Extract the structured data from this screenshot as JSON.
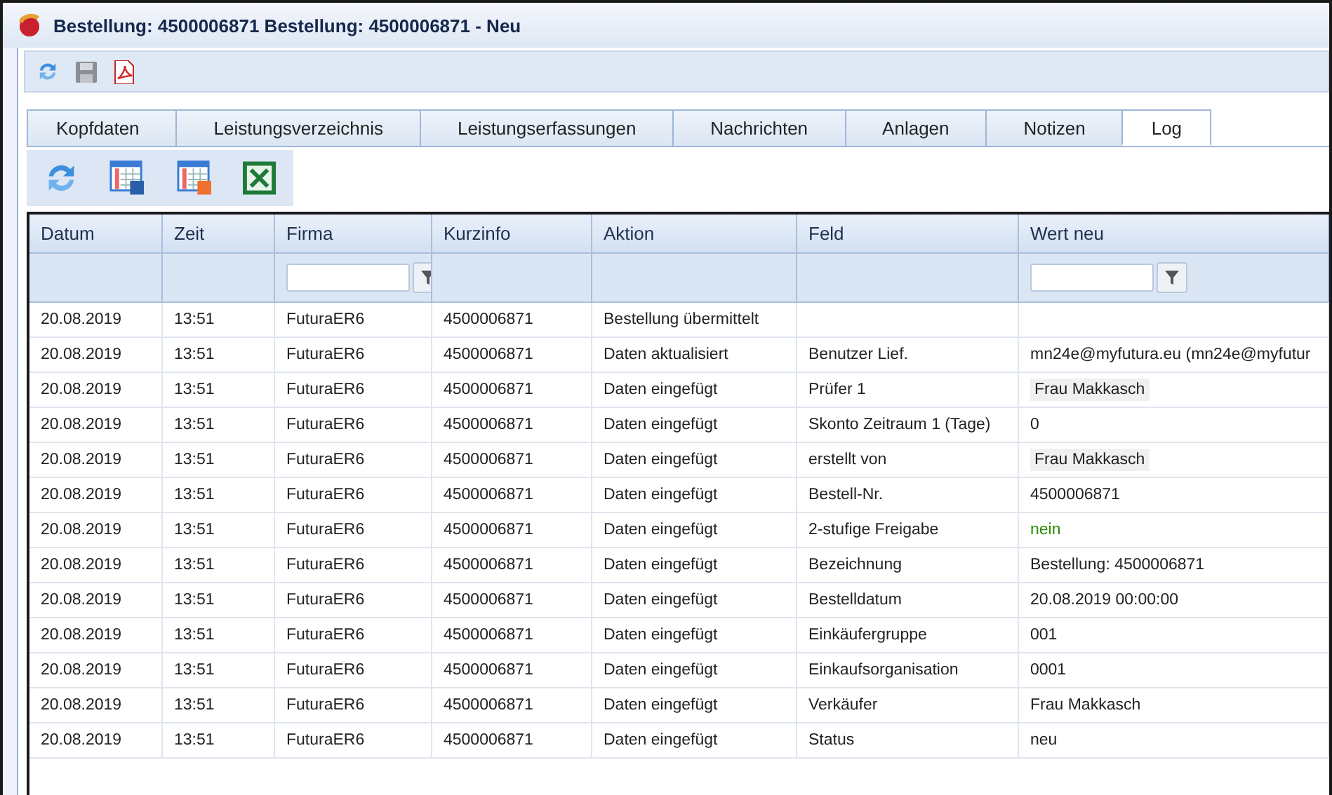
{
  "window": {
    "title": "Bestellung: 4500006871 Bestellung: 4500006871 - Neu"
  },
  "tabs": [
    {
      "label": "Kopfdaten",
      "selected": false
    },
    {
      "label": "Leistungsverzeichnis",
      "selected": false
    },
    {
      "label": "Leistungserfassungen",
      "selected": false
    },
    {
      "label": "Nachrichten",
      "selected": false
    },
    {
      "label": "Anlagen",
      "selected": false
    },
    {
      "label": "Notizen",
      "selected": false
    },
    {
      "label": "Log",
      "selected": true
    }
  ],
  "table": {
    "columns": [
      {
        "label": "Datum",
        "filter": false
      },
      {
        "label": "Zeit",
        "filter": false
      },
      {
        "label": "Firma",
        "filter": true
      },
      {
        "label": "Kurzinfo",
        "filter": false
      },
      {
        "label": "Aktion",
        "filter": false
      },
      {
        "label": "Feld",
        "filter": false
      },
      {
        "label": "Wert neu",
        "filter": true
      }
    ],
    "rows": [
      {
        "cells": [
          "20.08.2019",
          "13:51",
          "FuturaER6",
          "4500006871",
          "Bestellung übermittelt",
          "",
          ""
        ]
      },
      {
        "cells": [
          "20.08.2019",
          "13:51",
          "FuturaER6",
          "4500006871",
          "Daten aktualisiert",
          "Benutzer Lief.",
          "mn24e@myfutura.eu (mn24e@myfutur"
        ],
        "kind": "text"
      },
      {
        "cells": [
          "20.08.2019",
          "13:51",
          "FuturaER6",
          "4500006871",
          "Daten eingefügt",
          "Prüfer 1",
          "Frau Makkasch"
        ],
        "kind": "lookup"
      },
      {
        "cells": [
          "20.08.2019",
          "13:51",
          "FuturaER6",
          "4500006871",
          "Daten eingefügt",
          "Skonto Zeitraum 1 (Tage)",
          "0"
        ],
        "kind": "text"
      },
      {
        "cells": [
          "20.08.2019",
          "13:51",
          "FuturaER6",
          "4500006871",
          "Daten eingefügt",
          "erstellt von",
          "Frau Makkasch"
        ],
        "kind": "lookup"
      },
      {
        "cells": [
          "20.08.2019",
          "13:51",
          "FuturaER6",
          "4500006871",
          "Daten eingefügt",
          "Bestell-Nr.",
          "4500006871"
        ],
        "kind": "text"
      },
      {
        "cells": [
          "20.08.2019",
          "13:51",
          "FuturaER6",
          "4500006871",
          "Daten eingefügt",
          "2-stufige Freigabe",
          "nein"
        ],
        "kind": "boolean"
      },
      {
        "cells": [
          "20.08.2019",
          "13:51",
          "FuturaER6",
          "4500006871",
          "Daten eingefügt",
          "Bezeichnung",
          "Bestellung: 4500006871"
        ],
        "kind": "text"
      },
      {
        "cells": [
          "20.08.2019",
          "13:51",
          "FuturaER6",
          "4500006871",
          "Daten eingefügt",
          "Bestelldatum",
          "20.08.2019 00:00:00"
        ],
        "kind": "text"
      },
      {
        "cells": [
          "20.08.2019",
          "13:51",
          "FuturaER6",
          "4500006871",
          "Daten eingefügt",
          "Einkäufergruppe",
          "001"
        ],
        "kind": "text"
      },
      {
        "cells": [
          "20.08.2019",
          "13:51",
          "FuturaER6",
          "4500006871",
          "Daten eingefügt",
          "Einkaufsorganisation",
          "0001"
        ],
        "kind": "text"
      },
      {
        "cells": [
          "20.08.2019",
          "13:51",
          "FuturaER6",
          "4500006871",
          "Daten eingefügt",
          "Verkäufer",
          "Frau Makkasch"
        ],
        "kind": "text"
      },
      {
        "cells": [
          "20.08.2019",
          "13:51",
          "FuturaER6",
          "4500006871",
          "Daten eingefügt",
          "Status",
          "neu"
        ],
        "kind": "text"
      }
    ]
  }
}
